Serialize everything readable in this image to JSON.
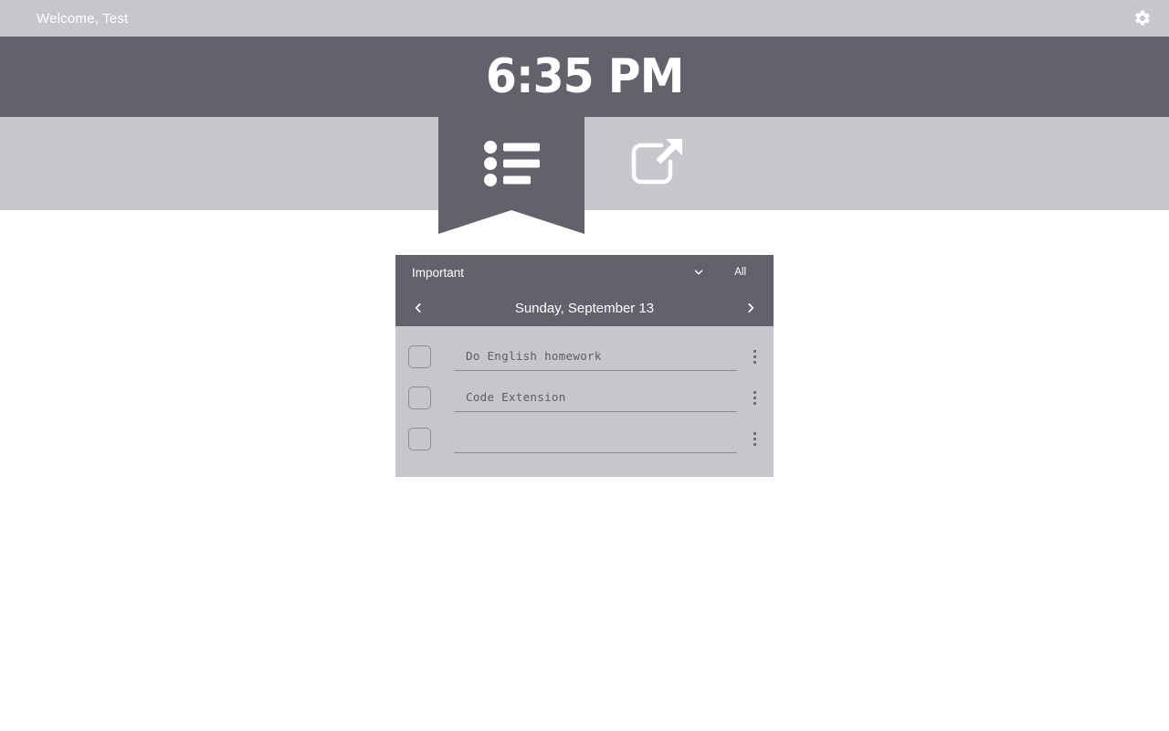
{
  "topbar": {
    "welcome": "Welcome, Test",
    "settings_icon": "gear-icon"
  },
  "clock": {
    "time": "6:35 PM"
  },
  "nav": {
    "tabs": [
      {
        "icon": "list-icon",
        "active": true
      },
      {
        "icon": "external-link-icon",
        "active": false
      }
    ]
  },
  "card": {
    "filter": {
      "selected": "Important",
      "options": [
        "Important",
        "All"
      ],
      "chevron_icon": "chevron-down-icon"
    },
    "all_label": "All",
    "date": {
      "label": "Sunday, September 13",
      "prev_icon": "chevron-left-icon",
      "next_icon": "chevron-right-icon"
    },
    "tasks": [
      {
        "text": "Do English homework",
        "placeholder": "",
        "checked": false
      },
      {
        "text": "Code Extension",
        "placeholder": "",
        "checked": false
      },
      {
        "text": "",
        "placeholder": "",
        "checked": false
      }
    ],
    "menu_icon": "kebab-menu-icon"
  },
  "colors": {
    "band_light": "#c7c6cc",
    "band_dark": "#64616d",
    "text_white": "#ffffff",
    "task_text": "#5d5c66",
    "page_bg": "#ffffff"
  }
}
